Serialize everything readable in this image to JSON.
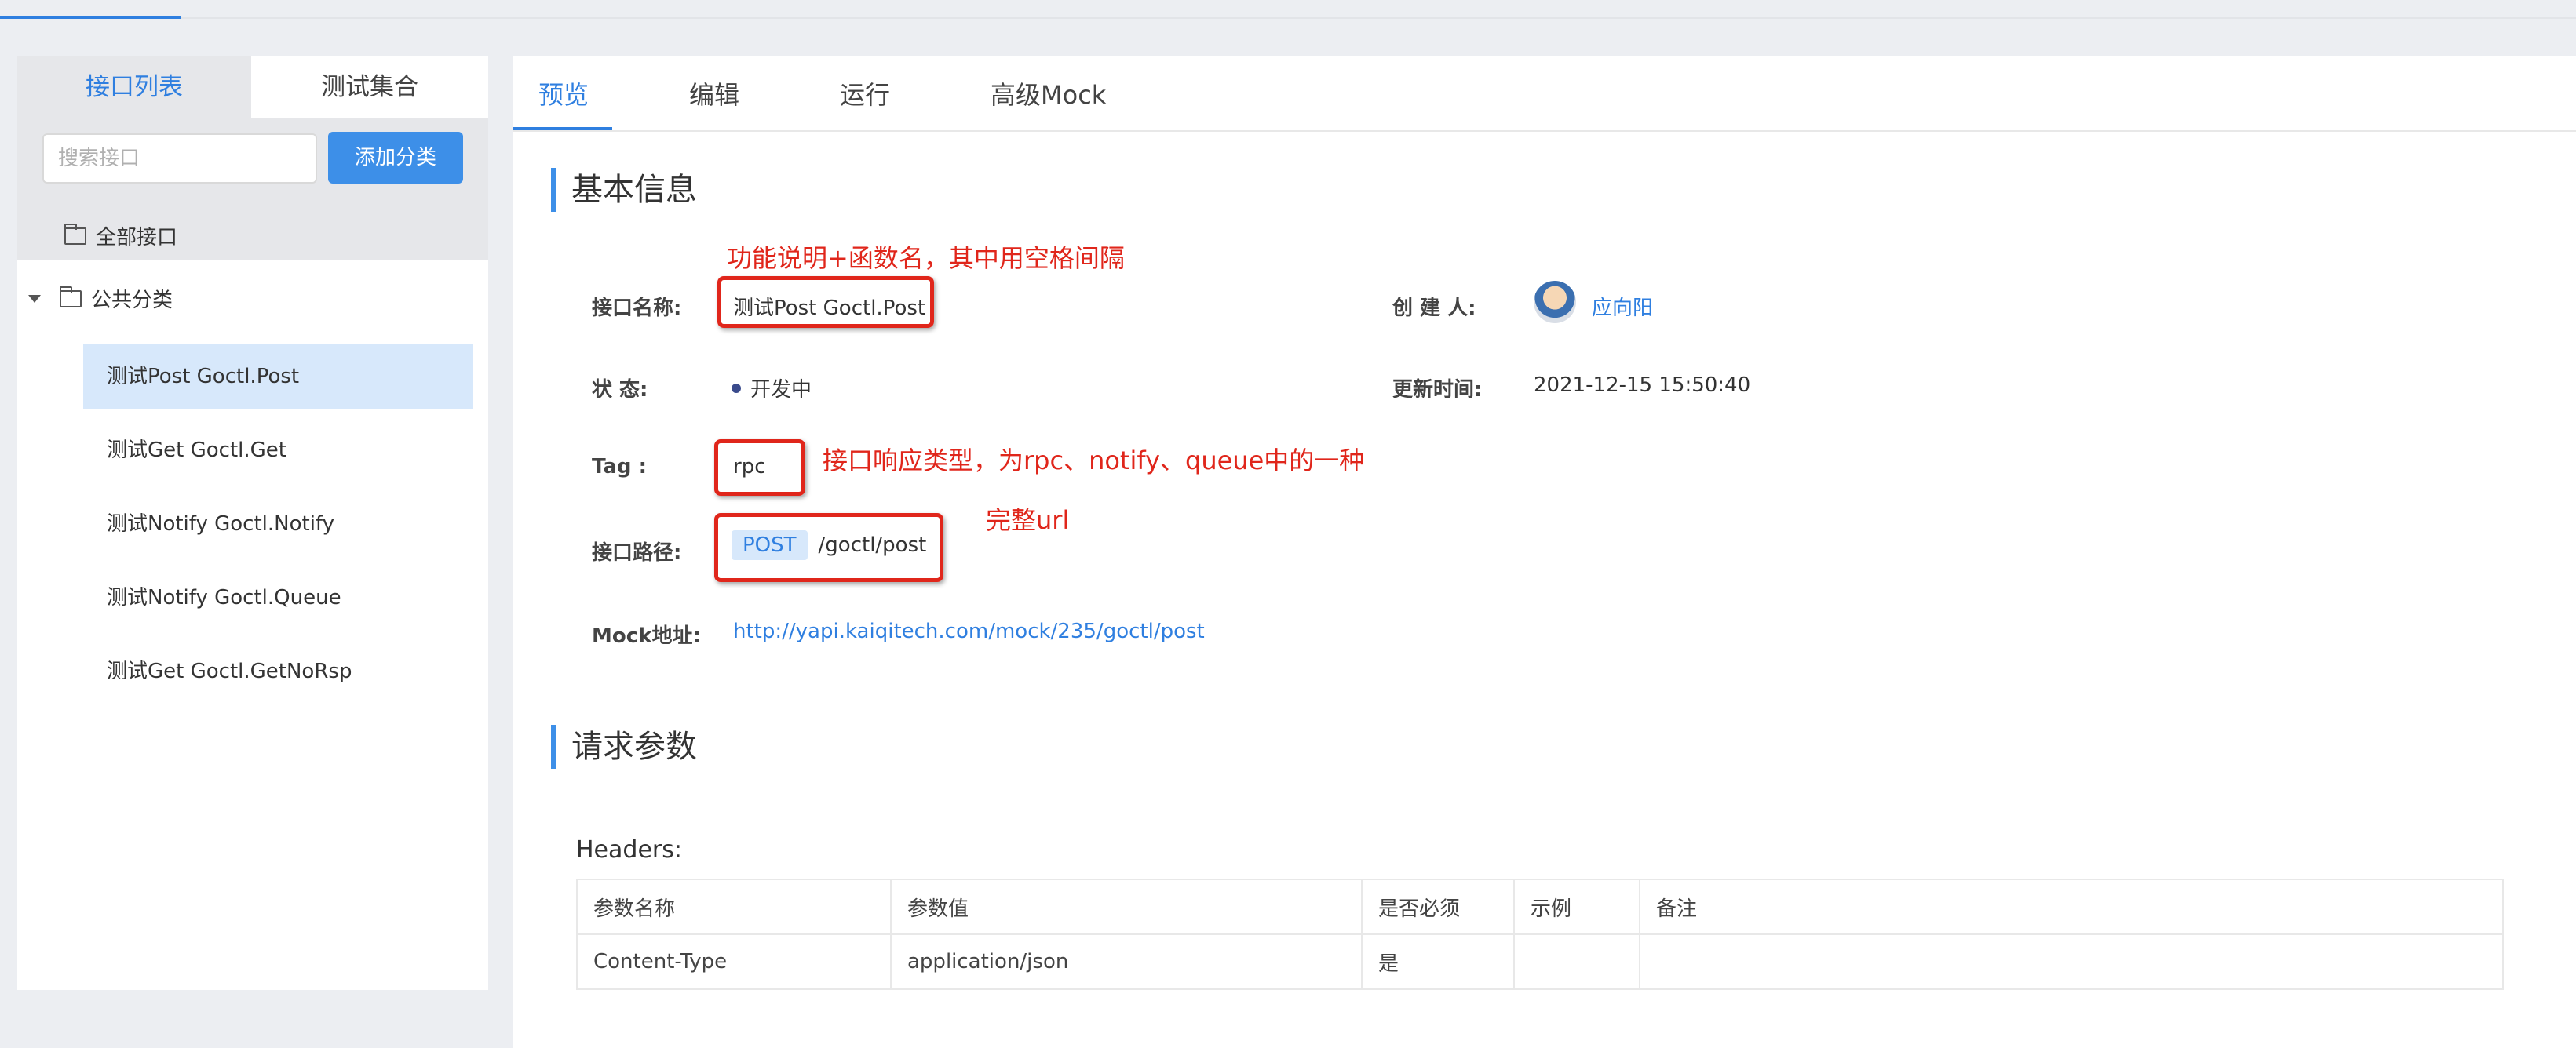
{
  "left_panel": {
    "tabs": [
      "接口列表",
      "测试集合"
    ],
    "search": {
      "placeholder": "搜索接口",
      "value": ""
    },
    "add_button": "添加分类",
    "all_apis": "全部接口",
    "category": "公共分类",
    "apis": [
      "测试Post Goctl.Post",
      "测试Get Goctl.Get",
      "测试Notify Goctl.Notify",
      "测试Notify Goctl.Queue",
      "测试Get Goctl.GetNoRsp"
    ]
  },
  "right_panel": {
    "tabs": [
      "预览",
      "编辑",
      "运行",
      "高级Mock"
    ],
    "basic_info": {
      "title": "基本信息",
      "name_label": "接口名称:",
      "name_value": "测试Post Goctl.Post",
      "creator_label": "创  建  人:",
      "creator_value": "应向阳",
      "status_label": "状      态:",
      "status_value": "开发中",
      "updated_label": "更新时间:",
      "updated_value": "2021-12-15 15:50:40",
      "tag_label": "Tag :",
      "tag_value": "rpc",
      "path_label": "接口路径:",
      "method": "POST",
      "path": "/goctl/post",
      "mock_label": "Mock地址:",
      "mock_url": "http://yapi.kaiqitech.com/mock/235/goctl/post"
    },
    "request_params": {
      "title": "请求参数",
      "headers_label": "Headers:",
      "columns": [
        "参数名称",
        "参数值",
        "是否必须",
        "示例",
        "备注"
      ],
      "rows": [
        [
          "Content-Type",
          "application/json",
          "是",
          "",
          ""
        ]
      ]
    }
  },
  "annotations": {
    "name_note": "功能说明+函数名，其中用空格间隔",
    "tag_note": "接口响应类型，为rpc、notify、queue中的一种",
    "path_note": "完整url"
  },
  "colors": {
    "accent": "#2f7fe0",
    "annotation": "#e0261b"
  }
}
